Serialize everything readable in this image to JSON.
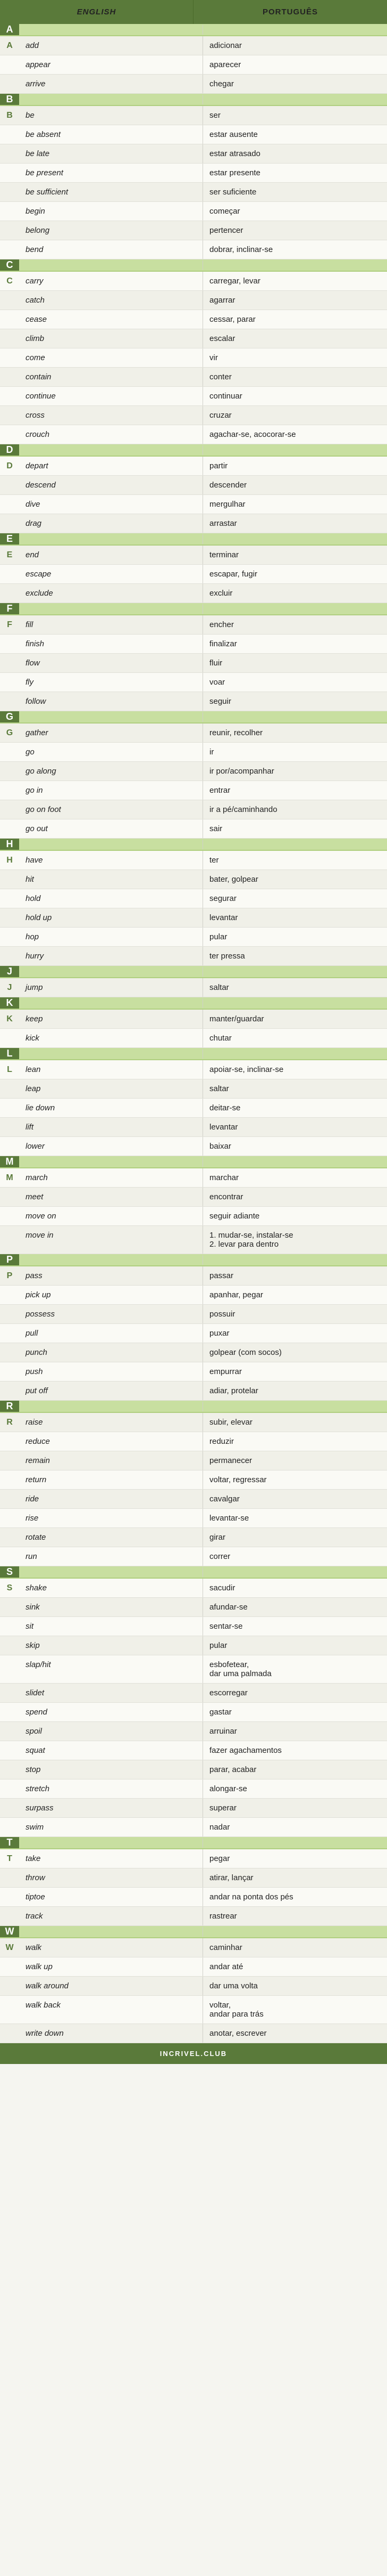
{
  "header": {
    "english": "ENGLISH",
    "portuguese": "PORTUGUÊS"
  },
  "sections": [
    {
      "letter": "A",
      "entries": [
        {
          "en": "add",
          "pt": "adicionar"
        },
        {
          "en": "appear",
          "pt": "aparecer"
        },
        {
          "en": "arrive",
          "pt": "chegar"
        }
      ]
    },
    {
      "letter": "B",
      "entries": [
        {
          "en": "be",
          "pt": "ser"
        },
        {
          "en": "be absent",
          "pt": "estar ausente"
        },
        {
          "en": "be late",
          "pt": "estar atrasado"
        },
        {
          "en": "be present",
          "pt": "estar presente"
        },
        {
          "en": "be sufficient",
          "pt": "ser suficiente"
        },
        {
          "en": "begin",
          "pt": "começar"
        },
        {
          "en": "belong",
          "pt": "pertencer"
        },
        {
          "en": "bend",
          "pt": "dobrar, inclinar-se"
        }
      ]
    },
    {
      "letter": "C",
      "entries": [
        {
          "en": "carry",
          "pt": "carregar, levar"
        },
        {
          "en": "catch",
          "pt": "agarrar"
        },
        {
          "en": "cease",
          "pt": "cessar, parar"
        },
        {
          "en": "climb",
          "pt": "escalar"
        },
        {
          "en": "come",
          "pt": "vir"
        },
        {
          "en": "contain",
          "pt": "conter"
        },
        {
          "en": "continue",
          "pt": "continuar"
        },
        {
          "en": "cross",
          "pt": "cruzar"
        },
        {
          "en": "crouch",
          "pt": "agachar-se, acocorar-se"
        }
      ]
    },
    {
      "letter": "D",
      "entries": [
        {
          "en": "depart",
          "pt": "partir"
        },
        {
          "en": "descend",
          "pt": "descender"
        },
        {
          "en": "dive",
          "pt": "mergulhar"
        },
        {
          "en": "drag",
          "pt": "arrastar"
        }
      ]
    },
    {
      "letter": "E",
      "entries": [
        {
          "en": "end",
          "pt": "terminar"
        },
        {
          "en": "escape",
          "pt": "escapar, fugir"
        },
        {
          "en": "exclude",
          "pt": "excluir"
        }
      ]
    },
    {
      "letter": "F",
      "entries": [
        {
          "en": "fill",
          "pt": "encher"
        },
        {
          "en": "finish",
          "pt": "finalizar"
        },
        {
          "en": "flow",
          "pt": "fluir"
        },
        {
          "en": "fly",
          "pt": "voar"
        },
        {
          "en": "follow",
          "pt": "seguir"
        }
      ]
    },
    {
      "letter": "G",
      "entries": [
        {
          "en": "gather",
          "pt": "reunir, recolher"
        },
        {
          "en": "go",
          "pt": "ir"
        },
        {
          "en": "go along",
          "pt": "ir por/acompanhar"
        },
        {
          "en": "go in",
          "pt": "entrar"
        },
        {
          "en": "go on foot",
          "pt": "ir a pé/caminhando"
        },
        {
          "en": "go out",
          "pt": "sair"
        }
      ]
    },
    {
      "letter": "H",
      "entries": [
        {
          "en": "have",
          "pt": "ter"
        },
        {
          "en": "hit",
          "pt": "bater, golpear"
        },
        {
          "en": "hold",
          "pt": "segurar"
        },
        {
          "en": "hold up",
          "pt": "levantar"
        },
        {
          "en": "hop",
          "pt": "pular"
        },
        {
          "en": "hurry",
          "pt": "ter pressa"
        }
      ]
    },
    {
      "letter": "J",
      "entries": [
        {
          "en": "jump",
          "pt": "saltar"
        }
      ]
    },
    {
      "letter": "K",
      "entries": [
        {
          "en": "keep",
          "pt": "manter/guardar"
        },
        {
          "en": "kick",
          "pt": "chutar"
        }
      ]
    },
    {
      "letter": "L",
      "entries": [
        {
          "en": "lean",
          "pt": "apoiar-se, inclinar-se"
        },
        {
          "en": "leap",
          "pt": "saltar"
        },
        {
          "en": "lie down",
          "pt": "deitar-se"
        },
        {
          "en": "lift",
          "pt": "levantar"
        },
        {
          "en": "lower",
          "pt": "baixar"
        }
      ]
    },
    {
      "letter": "M",
      "entries": [
        {
          "en": "march",
          "pt": "marchar"
        },
        {
          "en": "meet",
          "pt": "encontrar"
        },
        {
          "en": "move on",
          "pt": "seguir adiante"
        },
        {
          "en": "move in",
          "pt": "1. mudar-se, instalar-se\n2. levar para dentro"
        }
      ]
    },
    {
      "letter": "P",
      "entries": [
        {
          "en": "pass",
          "pt": "passar"
        },
        {
          "en": "pick up",
          "pt": "apanhar, pegar"
        },
        {
          "en": "possess",
          "pt": "possuir"
        },
        {
          "en": "pull",
          "pt": "puxar"
        },
        {
          "en": "punch",
          "pt": "golpear (com socos)"
        },
        {
          "en": "push",
          "pt": "empurrar"
        },
        {
          "en": "put off",
          "pt": "adiar, protelar"
        }
      ]
    },
    {
      "letter": "R",
      "entries": [
        {
          "en": "raise",
          "pt": "subir, elevar"
        },
        {
          "en": "reduce",
          "pt": "reduzir"
        },
        {
          "en": "remain",
          "pt": "permanecer"
        },
        {
          "en": "return",
          "pt": "voltar, regressar"
        },
        {
          "en": "ride",
          "pt": "cavalgar"
        },
        {
          "en": "rise",
          "pt": "levantar-se"
        },
        {
          "en": "rotate",
          "pt": "girar"
        },
        {
          "en": "run",
          "pt": "correr"
        }
      ]
    },
    {
      "letter": "S",
      "entries": [
        {
          "en": "shake",
          "pt": "sacudir"
        },
        {
          "en": "sink",
          "pt": "afundar-se"
        },
        {
          "en": "sit",
          "pt": "sentar-se"
        },
        {
          "en": "skip",
          "pt": "pular"
        },
        {
          "en": "slap/hit",
          "pt": "esbofetear,\ndar uma palmada"
        },
        {
          "en": "slidet",
          "pt": "escorregar"
        },
        {
          "en": "spend",
          "pt": "gastar"
        },
        {
          "en": "spoil",
          "pt": "arruinar"
        },
        {
          "en": "squat",
          "pt": "fazer agachamentos"
        },
        {
          "en": "stop",
          "pt": "parar, acabar"
        },
        {
          "en": "stretch",
          "pt": "alongar-se"
        },
        {
          "en": "surpass",
          "pt": "superar"
        },
        {
          "en": "swim",
          "pt": "nadar"
        }
      ]
    },
    {
      "letter": "T",
      "entries": [
        {
          "en": "take",
          "pt": "pegar"
        },
        {
          "en": "throw",
          "pt": "atirar, lançar"
        },
        {
          "en": "tiptoe",
          "pt": "andar na ponta dos pés"
        },
        {
          "en": "track",
          "pt": "rastrear"
        }
      ]
    },
    {
      "letter": "W",
      "entries": [
        {
          "en": "walk",
          "pt": "caminhar"
        },
        {
          "en": "walk up",
          "pt": "andar até"
        },
        {
          "en": "walk around",
          "pt": "dar uma volta"
        },
        {
          "en": "walk back",
          "pt": "voltar,\nandar para trás"
        },
        {
          "en": "write down",
          "pt": "anotar, escrever"
        }
      ]
    }
  ],
  "footer": {
    "label": "INCRIVEL.CLUB"
  }
}
